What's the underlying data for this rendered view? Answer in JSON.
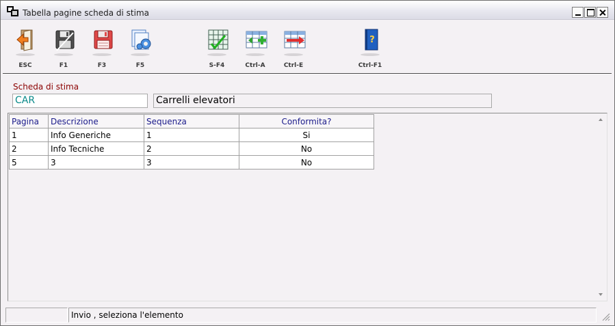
{
  "window": {
    "title": "Tabella pagine scheda di stima"
  },
  "toolbar": {
    "buttons": [
      {
        "key": "ESC",
        "icon": "exit-door-icon"
      },
      {
        "key": "F1",
        "icon": "save-disk-gray-icon"
      },
      {
        "key": "F3",
        "icon": "save-disk-red-icon"
      },
      {
        "key": "F5",
        "icon": "settings-pages-icon"
      },
      {
        "key": "S-F4",
        "icon": "grid-check-icon"
      },
      {
        "key": "Ctrl-A",
        "icon": "add-row-icon"
      },
      {
        "key": "Ctrl-E",
        "icon": "remove-row-icon"
      },
      {
        "key": "Ctrl-F1",
        "icon": "help-book-icon"
      }
    ]
  },
  "form": {
    "label": "Scheda di stima",
    "code": "CAR",
    "description": "Carrelli elevatori"
  },
  "grid": {
    "headers": {
      "pagina": "Pagina",
      "descrizione": "Descrizione",
      "sequenza": "Sequenza",
      "conformita": "Conformita?"
    },
    "rows": [
      {
        "pagina": "1",
        "descrizione": "Info Generiche",
        "sequenza": "1",
        "conformita": "Si"
      },
      {
        "pagina": "2",
        "descrizione": "Info Tecniche",
        "sequenza": "2",
        "conformita": "No"
      },
      {
        "pagina": "5",
        "descrizione": "3",
        "sequenza": "3",
        "conformita": "No"
      }
    ]
  },
  "status": {
    "message": "Invio , seleziona l'elemento"
  }
}
